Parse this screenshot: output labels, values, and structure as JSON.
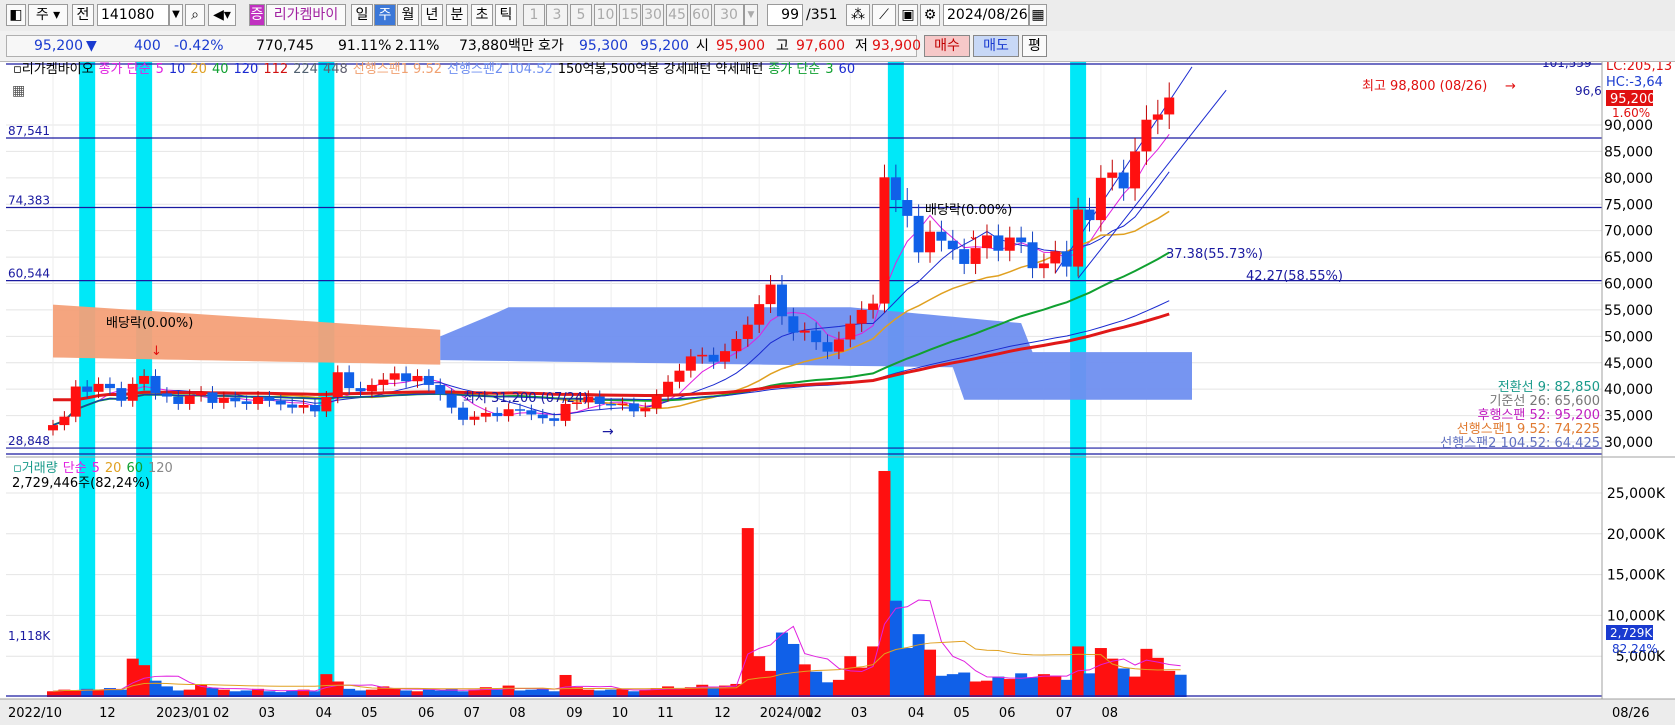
{
  "toolbar": {
    "period_type": "주",
    "prev_label": "전",
    "stock_code": "141080",
    "stock_name_tag": "증",
    "stock_name": "리가켐바이",
    "period_buttons": [
      "일",
      "주",
      "월",
      "년",
      "분",
      "초",
      "틱"
    ],
    "selected_period": "주",
    "interval_buttons": [
      "1",
      "3",
      "5",
      "10",
      "15",
      "30",
      "45",
      "60"
    ],
    "interval_value": "30",
    "page_counter": "99",
    "page_total": "/351",
    "date": "2024/08/26"
  },
  "quote": {
    "price": "95,200",
    "direction": "▼",
    "change": "400",
    "change_pct": "-0.42%",
    "volume": "770,745",
    "vol_ratio": "91.11%",
    "turnover": "2.11%",
    "amount": "73,880백만",
    "bid_ask_label": "호가",
    "ask": "95,300",
    "bid": "95,200",
    "open_label": "시",
    "open": "95,900",
    "high_label": "고",
    "high": "97,600",
    "low_label": "저",
    "low": "93,900",
    "buy_button": "매수",
    "sell_button": "매도",
    "eval_button": "평"
  },
  "legend": {
    "stock": "리가켐바이오",
    "ma_label": "종가 단순",
    "ma_periods": [
      "5",
      "10",
      "20",
      "40",
      "120",
      "112",
      "224",
      "448"
    ],
    "ma_colors": [
      "#e020e0",
      "#1a2ad0",
      "#e0a020",
      "#10a030",
      "#1a2ad0",
      "#d01010",
      "#506070",
      "#606070"
    ],
    "span1": "선행스팬1 9.52",
    "span2": "선행스팬2 104.52",
    "patterns": "150억봉,500억봉 강세패턴  약세패턴",
    "ma2_label": "종가 단순",
    "ma2_periods": [
      "3",
      "60"
    ]
  },
  "annotations": {
    "high_note": "최고 98,800 (08/26)",
    "low_note": "최저 31,200 (07/24)",
    "dividend_1": "배당락(0.00%)",
    "dividend_2": "배당락(0.00%)",
    "retrace_1": "37.38(55.73%)",
    "retrace_2": "42.27(58.55%)",
    "lc": "LC:205,13",
    "hc": "HC:-3,64",
    "trend_1": "101,559",
    "trend_2": "96,6",
    "current_price": "95,200",
    "current_pct": "1.60%",
    "hlines": [
      "87,541",
      "74,383",
      "60,544",
      "28,848"
    ],
    "ichimoku": [
      {
        "text": "전환선 9: 82,850",
        "color": "#1a9a8a"
      },
      {
        "text": "기준선 26: 65,600",
        "color": "#777777"
      },
      {
        "text": "후행스팬 52: 95,200",
        "color": "#c020c0"
      },
      {
        "text": "선행스팬1 9.52: 74,225",
        "color": "#e07a30"
      },
      {
        "text": "선행스팬2 104.52: 64,425",
        "color": "#6070c0"
      }
    ]
  },
  "volume_legend": {
    "label": "거래량",
    "ma_label": "단순",
    "periods": [
      "5",
      "20",
      "60",
      "120"
    ],
    "colors": [
      "#e020e0",
      "#e0a020",
      "#10a030",
      "#888888"
    ],
    "current": "2,729,446주(82,24%)",
    "ref_label": "1,118K",
    "current_tag": "2,729K",
    "pct_tag": "82.24%"
  },
  "colors": {
    "up": "#ff1010",
    "down": "#1060e8",
    "highlight": "#00e8f8",
    "cloud_bull": "#f4a078",
    "cloud_bear": "#6f8ff0"
  },
  "chart_data": {
    "type": "candlestick",
    "title": "리가켐바이오",
    "price_axis": {
      "ticks": [
        "90,000",
        "85,000",
        "80,000",
        "75,000",
        "70,000",
        "65,000",
        "60,000",
        "55,000",
        "50,000",
        "45,000",
        "40,000",
        "35,000",
        "30,000"
      ],
      "range": [
        27000,
        103000
      ]
    },
    "volume_axis": {
      "ticks": [
        "25,000K",
        "20,000K",
        "15,000K",
        "10,000K",
        "5,000K"
      ],
      "range": [
        0,
        30500
      ]
    },
    "x_labels": [
      {
        "label": "2022/10",
        "week": 0
      },
      {
        "label": "12",
        "week": 8
      },
      {
        "label": "2023/01",
        "week": 13
      },
      {
        "label": "02",
        "week": 18
      },
      {
        "label": "03",
        "week": 22
      },
      {
        "label": "04",
        "week": 27
      },
      {
        "label": "05",
        "week": 31
      },
      {
        "label": "06",
        "week": 36
      },
      {
        "label": "07",
        "week": 40
      },
      {
        "label": "08",
        "week": 44
      },
      {
        "label": "09",
        "week": 49
      },
      {
        "label": "10",
        "week": 53
      },
      {
        "label": "11",
        "week": 57
      },
      {
        "label": "12",
        "week": 62
      },
      {
        "label": "2024/01",
        "week": 66
      },
      {
        "label": "02",
        "week": 70
      },
      {
        "label": "03",
        "week": 74
      },
      {
        "label": "04",
        "week": 79
      },
      {
        "label": "05",
        "week": 83
      },
      {
        "label": "06",
        "week": 87
      },
      {
        "label": "07",
        "week": 92
      },
      {
        "label": "08",
        "week": 96
      }
    ],
    "last_label": "08/26",
    "highlight_weeks": [
      3,
      8,
      24,
      74,
      90
    ],
    "weekly_close": [
      33200,
      34800,
      40500,
      39500,
      41000,
      40200,
      37800,
      41000,
      42500,
      39200,
      38600,
      37200,
      38800,
      39400,
      37400,
      38400,
      37700,
      37200,
      38500,
      37800,
      37100,
      36500,
      37000,
      35800,
      38500,
      43200,
      40200,
      39600,
      40800,
      41800,
      43000,
      41500,
      42500,
      40800,
      39000,
      36500,
      34200,
      34800,
      35500,
      34900,
      36200,
      36000,
      35200,
      34500,
      34000,
      37200,
      37500,
      38600,
      37200,
      37100,
      37300,
      35800,
      36400,
      38800,
      41400,
      43500,
      46200,
      46500,
      45200,
      47200,
      49500,
      52200,
      56100,
      59800,
      53800,
      50700,
      51100,
      48900,
      47100,
      49400,
      52400,
      55000,
      56200,
      80100,
      75800,
      72800,
      65900,
      69800,
      68100,
      66500,
      63700,
      66700,
      69100,
      66200,
      68700,
      67800,
      62900,
      63800,
      66100,
      63200,
      74000,
      72000,
      80000,
      81000,
      78000,
      85000,
      91000,
      92000,
      95200
    ],
    "weekly_volume_k": [
      700,
      900,
      800,
      1000,
      900,
      1100,
      900,
      4700,
      3900,
      2000,
      1300,
      800,
      900,
      1500,
      1100,
      900,
      700,
      800,
      1000,
      700,
      600,
      800,
      900,
      700,
      2800,
      1900,
      1000,
      800,
      900,
      1300,
      1100,
      800,
      700,
      900,
      800,
      1000,
      700,
      900,
      1200,
      900,
      1400,
      800,
      900,
      1000,
      700,
      2700,
      1200,
      900,
      800,
      900,
      1000,
      700,
      900,
      1100,
      1300,
      1000,
      1200,
      1500,
      1100,
      1400,
      1600,
      20700,
      5000,
      3200,
      7900,
      6500,
      4000,
      3100,
      1800,
      2100,
      5000,
      3600,
      6200,
      27700,
      11800,
      6000,
      7700,
      5800,
      2600,
      2800,
      3000,
      1900,
      2000,
      2500,
      2200,
      2900,
      2400,
      2800,
      2600,
      2100,
      6200,
      2900,
      6000,
      4700,
      3500,
      2500,
      5900,
      4800,
      3200,
      2729
    ]
  }
}
